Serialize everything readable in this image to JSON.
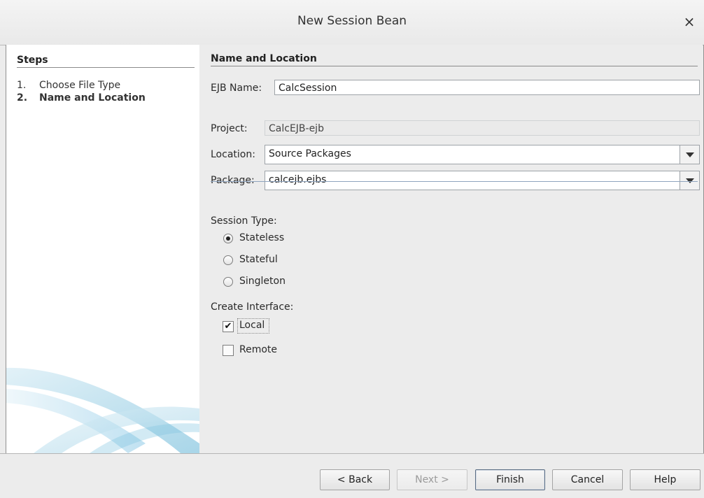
{
  "window": {
    "title": "New Session Bean",
    "close_glyph": "×"
  },
  "steps": {
    "heading": "Steps",
    "items": [
      {
        "num": "1.",
        "label": "Choose File Type"
      },
      {
        "num": "2.",
        "label": "Name and Location"
      }
    ]
  },
  "form": {
    "section_title": "Name and Location",
    "ejb_name_label": "EJB Name:",
    "ejb_name_value": "CalcSession",
    "project_label": "Project:",
    "project_value": "CalcEJB-ejb",
    "location_label": "Location:",
    "location_value": "Source Packages",
    "package_label": "Package:",
    "package_value": "calcejb.ejbs",
    "session_type_label": "Session Type:",
    "session_types": [
      "Stateless",
      "Stateful",
      "Singleton"
    ],
    "session_type_selected": "Stateless",
    "create_interface_label": "Create Interface:",
    "interfaces": [
      {
        "label": "Local",
        "checked": true
      },
      {
        "label": "Remote",
        "checked": false
      }
    ]
  },
  "buttons": {
    "back": "< Back",
    "next": "Next >",
    "finish": "Finish",
    "cancel": "Cancel",
    "help": "Help"
  },
  "colors": {
    "accent": "#5a6d84",
    "panel_bg": "#ececec",
    "steps_bg": "#ffffff"
  }
}
